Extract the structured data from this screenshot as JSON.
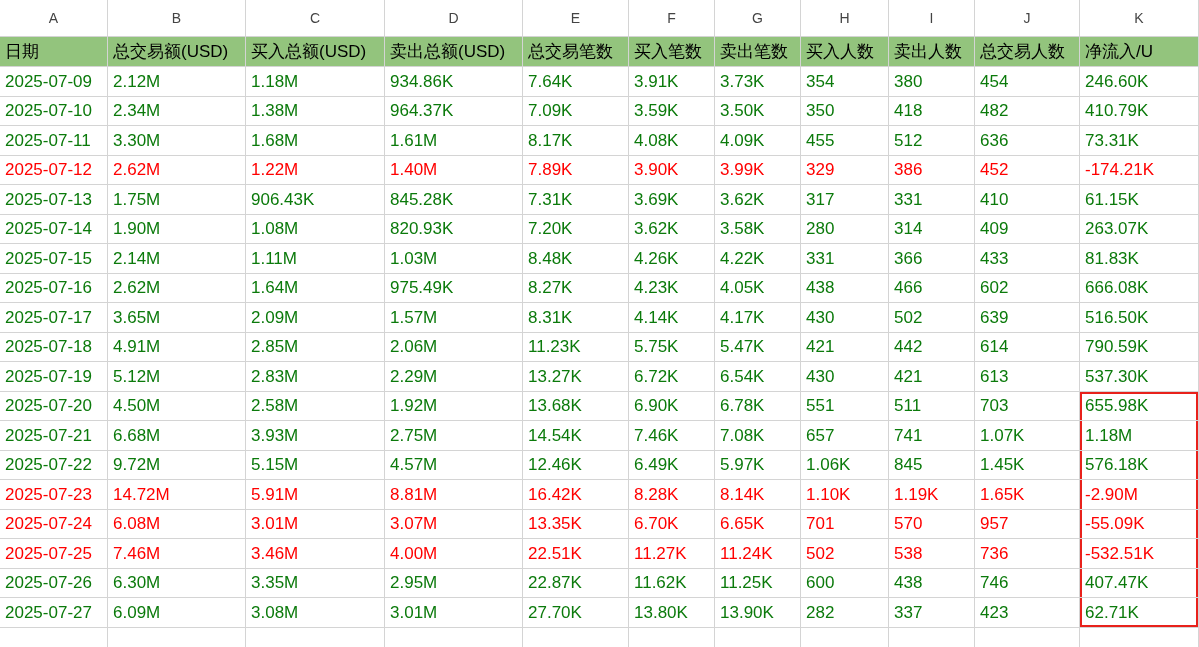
{
  "column_letters": [
    "A",
    "B",
    "C",
    "D",
    "E",
    "F",
    "G",
    "H",
    "I",
    "J",
    "K"
  ],
  "header": [
    "日期",
    "总交易额(USD)",
    "买入总额(USD)",
    "卖出总额(USD)",
    "总交易笔数",
    "买入笔数",
    "卖出笔数",
    "买入人数",
    "卖出人数",
    "总交易人数",
    "净流入/U"
  ],
  "rows": [
    {
      "negative": false,
      "boxed": false,
      "cells": [
        "2025-07-09",
        "2.12M",
        "1.18M",
        "934.86K",
        "7.64K",
        "3.91K",
        "3.73K",
        "354",
        "380",
        "454",
        "246.60K"
      ]
    },
    {
      "negative": false,
      "boxed": false,
      "cells": [
        "2025-07-10",
        "2.34M",
        "1.38M",
        "964.37K",
        "7.09K",
        "3.59K",
        "3.50K",
        "350",
        "418",
        "482",
        "410.79K"
      ]
    },
    {
      "negative": false,
      "boxed": false,
      "cells": [
        "2025-07-11",
        "3.30M",
        "1.68M",
        "1.61M",
        "8.17K",
        "4.08K",
        "4.09K",
        "455",
        "512",
        "636",
        "73.31K"
      ]
    },
    {
      "negative": true,
      "boxed": false,
      "cells": [
        "2025-07-12",
        "2.62M",
        "1.22M",
        "1.40M",
        "7.89K",
        "3.90K",
        "3.99K",
        "329",
        "386",
        "452",
        "-174.21K"
      ]
    },
    {
      "negative": false,
      "boxed": false,
      "cells": [
        "2025-07-13",
        "1.75M",
        "906.43K",
        "845.28K",
        "7.31K",
        "3.69K",
        "3.62K",
        "317",
        "331",
        "410",
        "61.15K"
      ]
    },
    {
      "negative": false,
      "boxed": false,
      "cells": [
        "2025-07-14",
        "1.90M",
        "1.08M",
        "820.93K",
        "7.20K",
        "3.62K",
        "3.58K",
        "280",
        "314",
        "409",
        "263.07K"
      ]
    },
    {
      "negative": false,
      "boxed": false,
      "cells": [
        "2025-07-15",
        "2.14M",
        "1.11M",
        "1.03M",
        "8.48K",
        "4.26K",
        "4.22K",
        "331",
        "366",
        "433",
        "81.83K"
      ]
    },
    {
      "negative": false,
      "boxed": false,
      "cells": [
        "2025-07-16",
        "2.62M",
        "1.64M",
        "975.49K",
        "8.27K",
        "4.23K",
        "4.05K",
        "438",
        "466",
        "602",
        "666.08K"
      ]
    },
    {
      "negative": false,
      "boxed": false,
      "cells": [
        "2025-07-17",
        "3.65M",
        "2.09M",
        "1.57M",
        "8.31K",
        "4.14K",
        "4.17K",
        "430",
        "502",
        "639",
        "516.50K"
      ]
    },
    {
      "negative": false,
      "boxed": false,
      "cells": [
        "2025-07-18",
        "4.91M",
        "2.85M",
        "2.06M",
        "11.23K",
        "5.75K",
        "5.47K",
        "421",
        "442",
        "614",
        "790.59K"
      ]
    },
    {
      "negative": false,
      "boxed": false,
      "cells": [
        "2025-07-19",
        "5.12M",
        "2.83M",
        "2.29M",
        "13.27K",
        "6.72K",
        "6.54K",
        "430",
        "421",
        "613",
        "537.30K"
      ]
    },
    {
      "negative": false,
      "boxed": true,
      "cells": [
        "2025-07-20",
        "4.50M",
        "2.58M",
        "1.92M",
        "13.68K",
        "6.90K",
        "6.78K",
        "551",
        "511",
        "703",
        "655.98K"
      ]
    },
    {
      "negative": false,
      "boxed": true,
      "cells": [
        "2025-07-21",
        "6.68M",
        "3.93M",
        "2.75M",
        "14.54K",
        "7.46K",
        "7.08K",
        "657",
        "741",
        "1.07K",
        "1.18M"
      ]
    },
    {
      "negative": false,
      "boxed": true,
      "cells": [
        "2025-07-22",
        "9.72M",
        "5.15M",
        "4.57M",
        "12.46K",
        "6.49K",
        "5.97K",
        "1.06K",
        "845",
        "1.45K",
        "576.18K"
      ]
    },
    {
      "negative": true,
      "boxed": true,
      "cells": [
        "2025-07-23",
        "14.72M",
        "5.91M",
        "8.81M",
        "16.42K",
        "8.28K",
        "8.14K",
        "1.10K",
        "1.19K",
        "1.65K",
        "-2.90M"
      ]
    },
    {
      "negative": true,
      "boxed": true,
      "cells": [
        "2025-07-24",
        "6.08M",
        "3.01M",
        "3.07M",
        "13.35K",
        "6.70K",
        "6.65K",
        "701",
        "570",
        "957",
        "-55.09K"
      ]
    },
    {
      "negative": true,
      "boxed": true,
      "cells": [
        "2025-07-25",
        "7.46M",
        "3.46M",
        "4.00M",
        "22.51K",
        "11.27K",
        "11.24K",
        "502",
        "538",
        "736",
        "-532.51K"
      ]
    },
    {
      "negative": false,
      "boxed": true,
      "cells": [
        "2025-07-26",
        "6.30M",
        "3.35M",
        "2.95M",
        "22.87K",
        "11.62K",
        "11.25K",
        "600",
        "438",
        "746",
        "407.47K"
      ]
    },
    {
      "negative": false,
      "boxed": true,
      "cells": [
        "2025-07-27",
        "6.09M",
        "3.08M",
        "3.01M",
        "27.70K",
        "13.80K",
        "13.90K",
        "282",
        "337",
        "423",
        "62.71K"
      ]
    }
  ]
}
